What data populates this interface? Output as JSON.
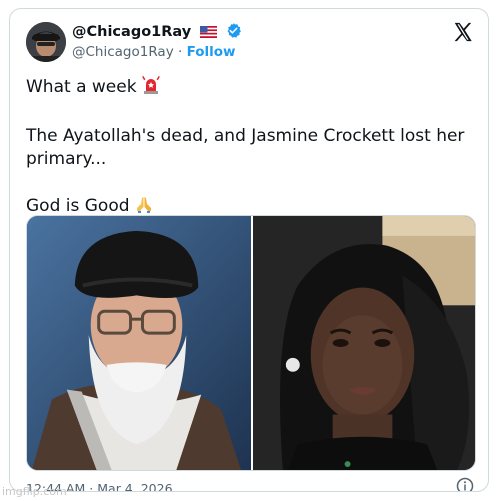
{
  "user": {
    "display_name": "@Chicago1Ray",
    "handle": "@Chicago1Ray",
    "separator": " · ",
    "follow_label": "Follow"
  },
  "post": {
    "line1": "What a week",
    "line2": "The Ayatollah's dead, and Jasmine Crockett lost her primary...",
    "line3": "God is Good"
  },
  "footer": {
    "timestamp": "12:44 AM · Mar 4, 2026"
  },
  "watermark": "imgflip.com",
  "icons": {
    "x_logo": "x-logo-icon",
    "verified": "verified-badge-icon",
    "flag": "us-flag-icon",
    "siren": "siren-emoji-icon",
    "pray": "folded-hands-emoji-icon",
    "info": "info-icon"
  },
  "colors": {
    "follow": "#1d9bf0",
    "verified": "#1d9bf0",
    "secondary_text": "#536471",
    "border": "#cfd9de"
  }
}
